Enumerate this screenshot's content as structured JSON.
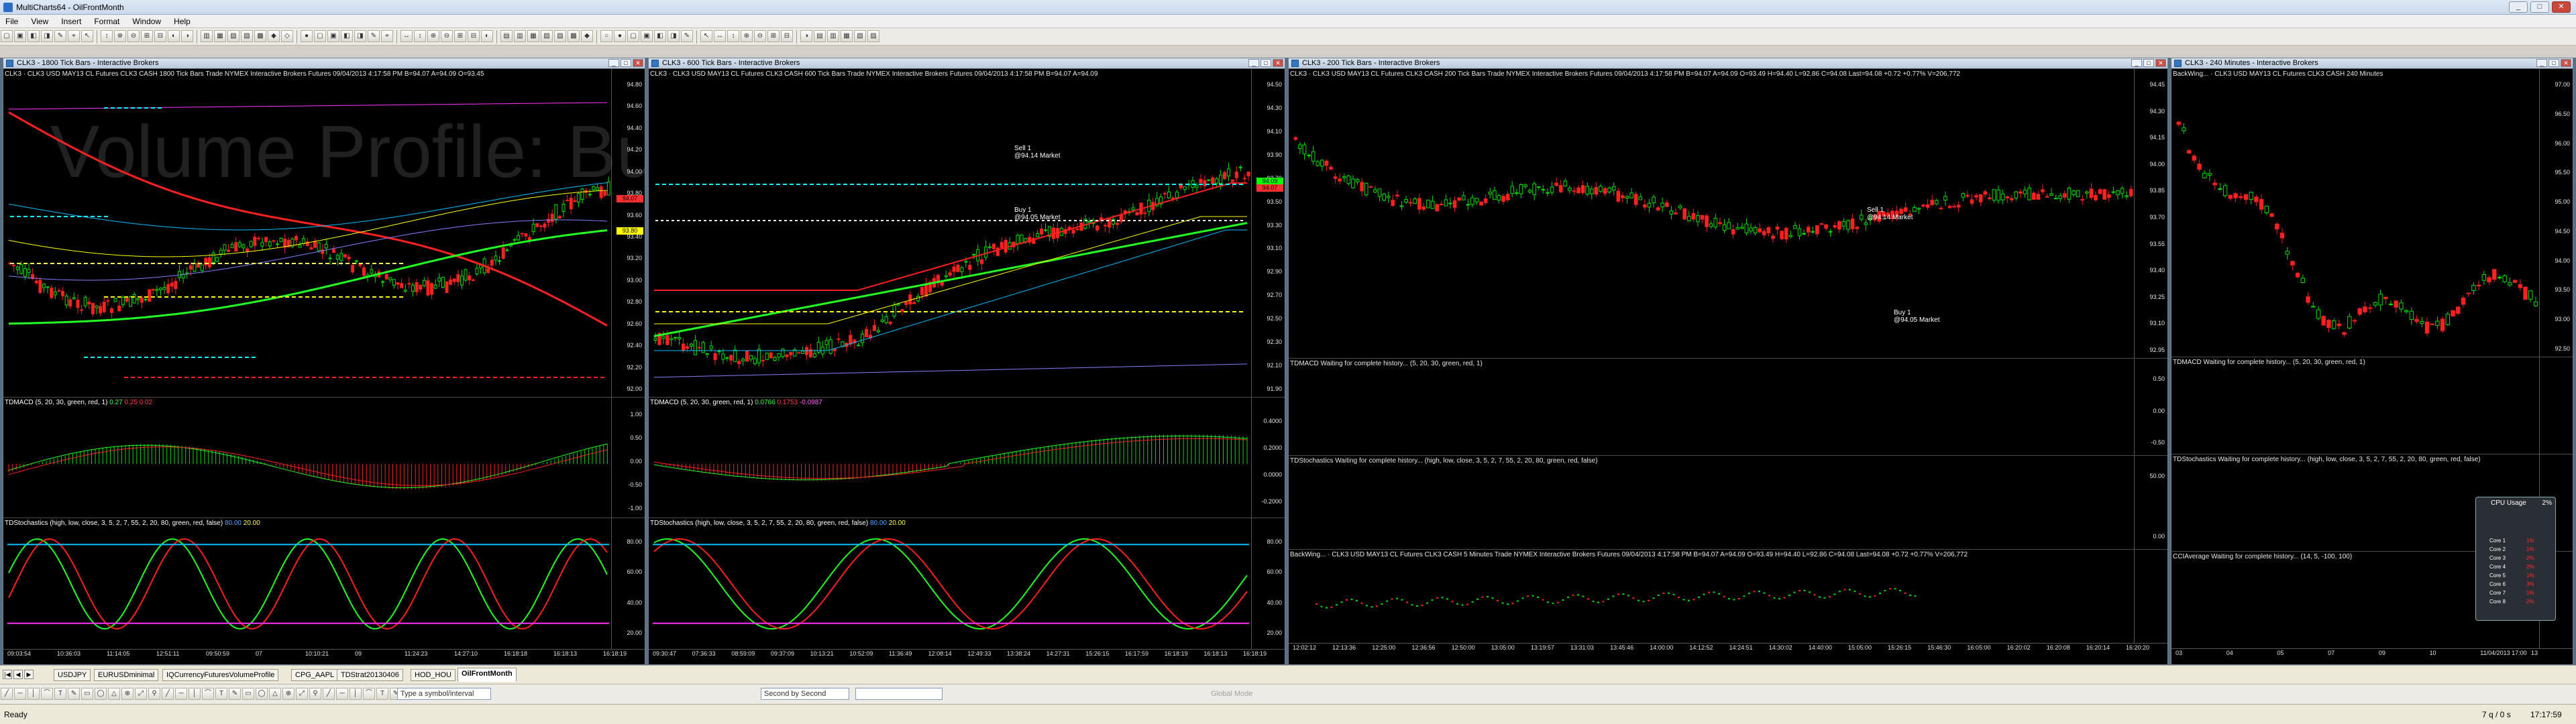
{
  "app": {
    "title": "MultiCharts64 - OilFrontMonth",
    "menu": [
      "File",
      "View",
      "Insert",
      "Format",
      "Window",
      "Help"
    ]
  },
  "colors": {
    "up": "#00cc00",
    "down": "#ff2020",
    "bg": "#000000",
    "axis": "#e0e0e0"
  },
  "windows": [
    {
      "id": "w1",
      "title": "CLK3 - 1800 Tick Bars - Interactive Brokers",
      "header": "CLK3 · CLK3   USD MAY13 CL Futures CLK3 CASH  1800 Tick Bars   Trade  NYMEX  Interactive Brokers  Futures   09/04/2013  4:17:58 PM  B=94.07  A=94.09  O=93.45",
      "watermark": "Volume Profile:\nBuild-in Big ...",
      "price_axis": [
        "94.80",
        "94.60",
        "94.40",
        "94.20",
        "94.00",
        "93.80",
        "93.60",
        "93.40",
        "93.20",
        "93.00",
        "92.80",
        "92.60",
        "92.40",
        "92.20",
        "92.00"
      ],
      "badges": [
        {
          "text": "94.07",
          "color": "#ff3030"
        },
        {
          "text": "93.80",
          "color": "#ffff00"
        }
      ],
      "macd_label": "TDMACD (5, 20, 30, green, red, 1)",
      "macd_vals": [
        "0.27",
        "0.25",
        "0.02"
      ],
      "macd_axis": [
        "1.00",
        "0.50",
        "0.00",
        "-0.50",
        "-1.00"
      ],
      "stoch_label": "TDStochastics (high, low, close, 3, 5, 2, 7, 55, 2, 20, 80, green, red, false)",
      "stoch_vals": [
        "80.00",
        "20.00"
      ],
      "stoch_axis": [
        "80.00",
        "60.00",
        "40.00",
        "20.00"
      ],
      "time_axis": [
        "09:03:54",
        "10:36:03",
        "11:14:05",
        "12:51:11",
        "09:50:59",
        "07",
        "10:10:21",
        "09",
        "11:24:23",
        "14:27:10",
        "16:18:18",
        "16:18:13",
        "16:18:19"
      ]
    },
    {
      "id": "w2",
      "title": "CLK3 - 600 Tick Bars - Interactive Brokers",
      "header": "CLK3 · CLK3   USD MAY13 CL Futures CLK3 CASH  600 Tick Bars   Trade  NYMEX  Interactive Brokers  Futures   09/04/2013  4:17:58 PM  B=94.07  A=94.09",
      "price_axis": [
        "94.50",
        "94.30",
        "94.10",
        "93.90",
        "93.70",
        "93.50",
        "93.30",
        "93.10",
        "92.90",
        "92.70",
        "92.50",
        "92.30",
        "92.10",
        "91.90"
      ],
      "badges": [
        {
          "text": "94.09",
          "color": "#00ff00"
        },
        {
          "text": "94.07",
          "color": "#ff3030"
        }
      ],
      "sell_label": "Sell 1",
      "sell_price": "@94.14 Market",
      "buy_label": "Buy 1",
      "buy_price": "@94.05 Market",
      "macd_label": "TDMACD (5, 20, 30, green, red, 1)",
      "macd_vals": [
        "0.0766",
        "0.1753",
        "-0.0987"
      ],
      "macd_axis": [
        "0.4000",
        "0.2000",
        "0.0000",
        "-0.2000"
      ],
      "stoch_label": "TDStochastics (high, low, close, 3, 5, 2, 7, 55, 2, 20, 80, green, red, false)",
      "stoch_vals": [
        "80.00",
        "20.00"
      ],
      "stoch_axis": [
        "80.00",
        "60.00",
        "40.00",
        "20.00"
      ],
      "time_axis": [
        "09:30:47",
        "07:36:33",
        "08:59:09",
        "09:37:09",
        "10:13:21",
        "10:52:09",
        "11:36:49",
        "12:08:14",
        "12:49:33",
        "13:38:24",
        "14:27:31",
        "15:26:15",
        "16:17:59",
        "16:18:19",
        "16:18:13",
        "16:18:19"
      ]
    },
    {
      "id": "w3",
      "title": "CLK3 - 200 Tick Bars - Interactive Brokers",
      "header": "CLK3 · CLK3   USD MAY13 CL Futures CLK3 CASH  200 Tick Bars   Trade  NYMEX  Interactive Brokers  Futures   09/04/2013  4:17:58 PM  B=94.07  A=94.09  O=93.49  H=94.40  L=92.86  C=94.08  Last=94.08  +0.72  +0.77%  V=206,772",
      "price_axis": [
        "94.45",
        "94.30",
        "94.15",
        "94.00",
        "93.85",
        "93.70",
        "93.55",
        "93.40",
        "93.25",
        "93.10",
        "92.95"
      ],
      "sell_label": "Sell 1",
      "sell_price": "@94.14 Market",
      "buy_label": "Buy 1",
      "buy_price": "@94.05 Market",
      "macd_label": "TDMACD Waiting for complete history...  (5, 20, 30, green, red, 1)",
      "macd_axis": [
        "0.50",
        "0.00",
        "-0.50"
      ],
      "stoch_label": "TDStochastics Waiting for complete history...  (high, low, close, 3, 5, 2, 7, 55, 2, 20, 80, green, red, false)",
      "stoch_axis": [
        "50.00",
        "0.00"
      ],
      "sub_header": "BackWing... · CLK3   USD MAY13 CL Futures CLK3 CASH  5 Minutes   Trade  NYMEX  Interactive Brokers  Futures   09/04/2013  4:17:58 PM  B=94.07  A=94.09  O=93.49  H=94.40  L=92.86  C=94.08  Last=94.08  +0.72  +0.77%  V=206,772",
      "time_axis": [
        "12:02:12",
        "12:13:36",
        "12:25:00",
        "12:36:56",
        "12:50:00",
        "13:05:00",
        "13:19:57",
        "13:31:03",
        "13:45:46",
        "14:00:00",
        "14:12:52",
        "14:24:51",
        "14:30:02",
        "14:40:00",
        "15:05:00",
        "15:26:15",
        "15:46:30",
        "16:05:00",
        "16:20:02",
        "16:20:08",
        "16:20:14",
        "16:20:20"
      ]
    },
    {
      "id": "w4",
      "title": "CLK3 - 240 Minutes - Interactive Brokers",
      "header": "BackWing... · CLK3   USD MAY13 CL Futures CLK3 CASH  240 Minutes",
      "price_axis": [
        "97.00",
        "96.50",
        "96.00",
        "95.50",
        "95.00",
        "94.50",
        "94.00",
        "93.50",
        "93.00",
        "92.50"
      ],
      "macd_label": "TDMACD Waiting for complete history...  (5, 20, 30, green, red, 1)",
      "stoch_label": "TDStochastics Waiting for complete history...  (high, low, close, 3, 5, 2, 7, 55, 2, 20, 80, green, red, false)",
      "cci_label": "CCIAverage Waiting for complete history...  (14, 5, -100, 100)",
      "time_axis": [
        "03",
        "04",
        "05",
        "07",
        "09",
        "10",
        "11/04/2013 17:00",
        "13"
      ]
    }
  ],
  "cpu_widget": {
    "title": "CPU Usage",
    "percent": "2%",
    "cores": [
      {
        "name": "Core 1",
        "val": "1%"
      },
      {
        "name": "Core 2",
        "val": "1%"
      },
      {
        "name": "Core 3",
        "val": "2%"
      },
      {
        "name": "Core 4",
        "val": "2%"
      },
      {
        "name": "Core 5",
        "val": "1%"
      },
      {
        "name": "Core 6",
        "val": "3%"
      },
      {
        "name": "Core 7",
        "val": "1%"
      },
      {
        "name": "Core 8",
        "val": "2%"
      }
    ]
  },
  "tabs": [
    "USDJPY",
    "EURUSDminimal",
    "IQCurrencyFuturesVolumeProfile",
    "CPG_AAPL",
    "TDStrat20130406",
    "HOD_HOU",
    "OilFrontMonth"
  ],
  "active_tab": "OilFrontMonth",
  "drawbar": {
    "symbol_placeholder": "Type a symbol/interval",
    "resolution": "Second by Second",
    "global_mode": "Global Mode"
  },
  "status": {
    "left": "Ready",
    "right_count": "7 q / 0 s",
    "clock": "17:17:59"
  }
}
